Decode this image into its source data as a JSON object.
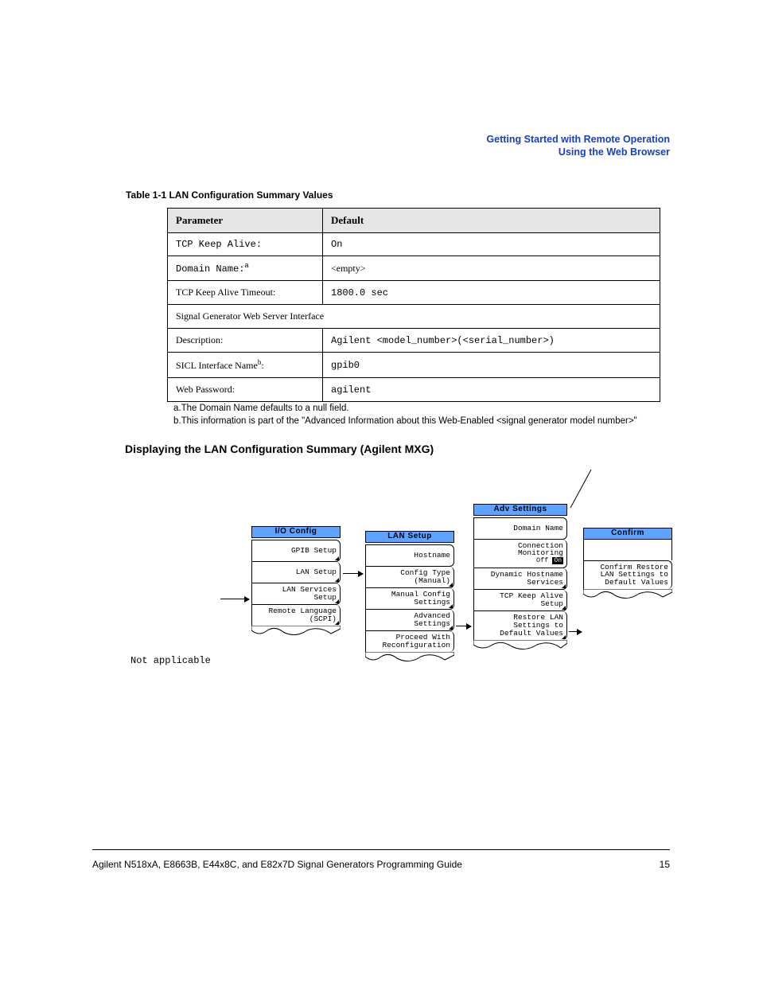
{
  "header": {
    "line1": "Getting Started with Remote Operation",
    "line2": "Using the Web Browser"
  },
  "table_caption": "Table 1-1   LAN Configuration Summary Values",
  "table": {
    "headers": {
      "parameter": "Parameter",
      "default": "Default"
    },
    "rows": [
      {
        "param": "TCP Keep Alive:",
        "param_class": "mono",
        "default": "On",
        "default_class": "mono"
      },
      {
        "param": "Domain Name:",
        "param_sup": "a",
        "param_class": "mono",
        "default": "<empty>",
        "default_class": "serif"
      },
      {
        "param": "TCP Keep Alive Timeout:",
        "param_class": "serif",
        "default": "1800.0 sec",
        "default_class": "mono"
      },
      {
        "param": "Signal Generator Web Server Interface",
        "span": true,
        "param_class": "serif"
      },
      {
        "param": "Description:",
        "param_class": "serif",
        "default": "Agilent <model_number>(<serial_number>)",
        "default_class": "mono"
      },
      {
        "param": "SICL Interface Name",
        "param_sup": "b",
        "param_suffix": ":",
        "param_class": "serif",
        "default": "gpib0",
        "default_class": "mono"
      },
      {
        "param": "Web Password:",
        "param_class": "serif",
        "default": "agilent",
        "default_class": "mono"
      }
    ]
  },
  "footnotes": {
    "a": "a.The Domain Name defaults to a null field.",
    "b": "b.This information is part of the \"Advanced Information about this Web-Enabled <signal generator model number>\""
  },
  "section_title": "Displaying the LAN Configuration Summary (Agilent MXG)",
  "not_applicable": "Not applicable",
  "menus": {
    "io_config": {
      "title": "I/O Config",
      "items": [
        "GPIB Setup",
        "LAN Setup",
        "LAN Services\nSetup",
        "Remote Language\n(SCPI)"
      ]
    },
    "lan_setup": {
      "title": "LAN Setup",
      "items": [
        "Hostname",
        "Config Type\n(Manual)",
        "Manual Config\nSettings",
        "Advanced\nSettings",
        "Proceed With\nReconfiguration"
      ]
    },
    "adv_settings": {
      "title": "Adv Settings",
      "items": [
        "Domain Name",
        "Connection\nMonitoring\nOff  On",
        "Dynamic Hostname\nServices",
        "TCP Keep Alive\nSetup",
        "Restore LAN\nSettings to\nDefault Values"
      ]
    },
    "confirm": {
      "title": "Confirm",
      "items": [
        "Confirm Restore\nLAN Settings to\nDefault Values"
      ]
    }
  },
  "footer": {
    "left": "Agilent N518xA, E8663B, E44x8C, and E82x7D Signal Generators Programming Guide",
    "right": "15"
  }
}
